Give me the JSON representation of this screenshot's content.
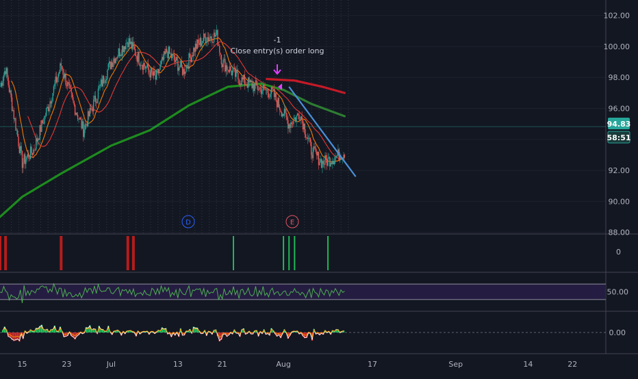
{
  "chart_data": {
    "type": "candlestick",
    "price_axis": {
      "ticks": [
        "102.00",
        "100.00",
        "98.00",
        "96.00",
        "94.00",
        "92.00",
        "90.00",
        "88.00"
      ],
      "tick_values": [
        102,
        100,
        98,
        96,
        94,
        92,
        90,
        88
      ],
      "range": [
        87.9,
        103
      ]
    },
    "last_price": {
      "label": "94.83",
      "value": 94.83,
      "countdown": "58:51",
      "color": "#26a69a"
    },
    "x_axis": {
      "ticks": [
        "15",
        "23",
        "Jul",
        "13",
        "21",
        "Aug",
        "17",
        "Sep",
        "14",
        "22"
      ],
      "start": "2020-06-11",
      "end": "2020-09-28",
      "last_candle": "2020-08-12"
    },
    "annotations": {
      "order_count": "-1",
      "order_text": "Close entry(s) order long",
      "event_d": "D",
      "event_e": "E"
    },
    "price_series_key": [
      {
        "date": "2020-06-11",
        "close": 97.4
      },
      {
        "date": "2020-06-12",
        "close": 98.6
      },
      {
        "date": "2020-06-15",
        "close": 92.5
      },
      {
        "date": "2020-06-17",
        "close": 93.3
      },
      {
        "date": "2020-06-20",
        "close": 96.5
      },
      {
        "date": "2020-06-22",
        "close": 98.8
      },
      {
        "date": "2020-06-24",
        "close": 96.5
      },
      {
        "date": "2020-06-26",
        "close": 94.6
      },
      {
        "date": "2020-06-29",
        "close": 97.4
      },
      {
        "date": "2020-07-01",
        "close": 99.0
      },
      {
        "date": "2020-07-04",
        "close": 100.4
      },
      {
        "date": "2020-07-06",
        "close": 99.2
      },
      {
        "date": "2020-07-09",
        "close": 97.9
      },
      {
        "date": "2020-07-11",
        "close": 99.7
      },
      {
        "date": "2020-07-14",
        "close": 98.4
      },
      {
        "date": "2020-07-16",
        "close": 99.9
      },
      {
        "date": "2020-07-18",
        "close": 100.6
      },
      {
        "date": "2020-07-20",
        "close": 100.7
      },
      {
        "date": "2020-07-21",
        "close": 99.0
      },
      {
        "date": "2020-07-24",
        "close": 97.9
      },
      {
        "date": "2020-07-27",
        "close": 97.4
      },
      {
        "date": "2020-07-30",
        "close": 97.0
      },
      {
        "date": "2020-08-02",
        "close": 95.0
      },
      {
        "date": "2020-08-04",
        "close": 95.7
      },
      {
        "date": "2020-08-06",
        "close": 93.3
      },
      {
        "date": "2020-08-08",
        "close": 92.5
      },
      {
        "date": "2020-08-10",
        "close": 92.8
      },
      {
        "date": "2020-08-12",
        "close": 93.2
      }
    ],
    "moving_averages": [
      {
        "color": "#1e8c1e",
        "points": [
          {
            "date": "2020-06-11",
            "value": 89.0
          },
          {
            "date": "2020-06-15",
            "value": 90.3
          },
          {
            "date": "2020-06-22",
            "value": 91.8
          },
          {
            "date": "2020-07-01",
            "value": 93.6
          },
          {
            "date": "2020-07-08",
            "value": 94.6
          },
          {
            "date": "2020-07-15",
            "value": 96.2
          },
          {
            "date": "2020-07-22",
            "value": 97.4
          },
          {
            "date": "2020-07-28",
            "value": 97.6
          },
          {
            "date": "2020-08-01",
            "value": 97.2
          }
        ]
      },
      {
        "color": "#2e7d32",
        "points": [
          {
            "date": "2020-08-01",
            "value": 97.2
          },
          {
            "date": "2020-08-06",
            "value": 96.3
          },
          {
            "date": "2020-08-12",
            "value": 95.5
          }
        ]
      },
      {
        "color": "#c41a27",
        "points": [
          {
            "date": "2020-07-29",
            "value": 97.9
          },
          {
            "date": "2020-08-03",
            "value": 97.8
          },
          {
            "date": "2020-08-08",
            "value": 97.4
          },
          {
            "date": "2020-08-12",
            "value": 97.0
          }
        ]
      }
    ],
    "trendline": {
      "color": "#4a90d9",
      "from": {
        "date": "2020-08-02",
        "value": 97.4
      },
      "to": {
        "date": "2020-08-14",
        "value": 91.6
      }
    },
    "panes": {
      "signals": {
        "y_tick": "0",
        "red_bars": [
          "2020-06-11",
          "2020-06-12",
          "2020-06-22",
          "2020-07-04",
          "2020-07-05"
        ],
        "green_bars": [
          "2020-07-23",
          "2020-08-01",
          "2020-08-02",
          "2020-08-03",
          "2020-08-09"
        ]
      },
      "rsi": {
        "y_tick": "50.00",
        "band": [
          30,
          70
        ]
      },
      "macd": {
        "y_tick": "0.00"
      }
    }
  }
}
